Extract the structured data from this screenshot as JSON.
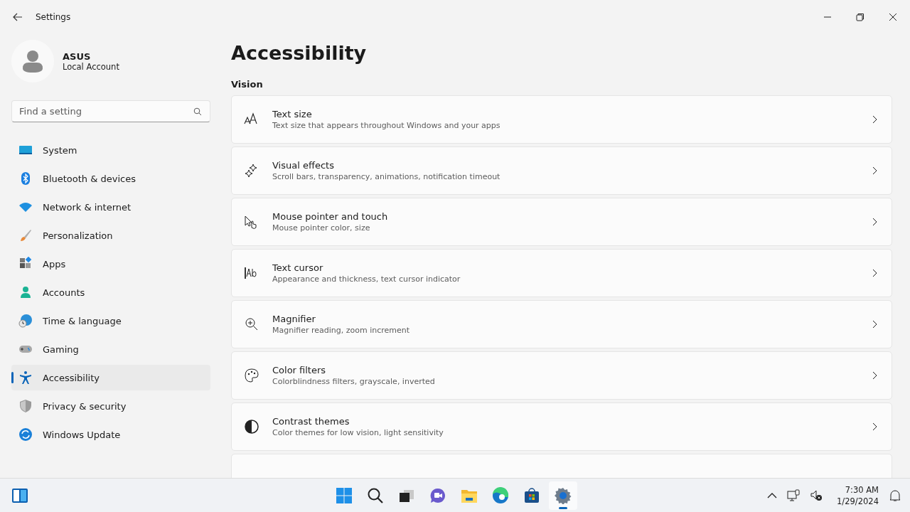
{
  "window": {
    "title": "Settings"
  },
  "account": {
    "name": "ASUS",
    "type": "Local Account"
  },
  "search": {
    "placeholder": "Find a setting"
  },
  "nav": [
    {
      "label": "System",
      "selected": false
    },
    {
      "label": "Bluetooth & devices",
      "selected": false
    },
    {
      "label": "Network & internet",
      "selected": false
    },
    {
      "label": "Personalization",
      "selected": false
    },
    {
      "label": "Apps",
      "selected": false
    },
    {
      "label": "Accounts",
      "selected": false
    },
    {
      "label": "Time & language",
      "selected": false
    },
    {
      "label": "Gaming",
      "selected": false
    },
    {
      "label": "Accessibility",
      "selected": true
    },
    {
      "label": "Privacy & security",
      "selected": false
    },
    {
      "label": "Windows Update",
      "selected": false
    }
  ],
  "page": {
    "title": "Accessibility",
    "section": "Vision",
    "items": [
      {
        "title": "Text size",
        "subtitle": "Text size that appears throughout Windows and your apps"
      },
      {
        "title": "Visual effects",
        "subtitle": "Scroll bars, transparency, animations, notification timeout"
      },
      {
        "title": "Mouse pointer and touch",
        "subtitle": "Mouse pointer color, size"
      },
      {
        "title": "Text cursor",
        "subtitle": "Appearance and thickness, text cursor indicator"
      },
      {
        "title": "Magnifier",
        "subtitle": "Magnifier reading, zoom increment"
      },
      {
        "title": "Color filters",
        "subtitle": "Colorblindness filters, grayscale, inverted"
      },
      {
        "title": "Contrast themes",
        "subtitle": "Color themes for low vision, light sensitivity"
      },
      {
        "kind": "cut-off"
      }
    ]
  },
  "taskbar": {
    "apps": [
      {
        "selected": false
      },
      {
        "selected": false
      },
      {
        "selected": false
      },
      {
        "selected": false
      },
      {
        "selected": false
      },
      {
        "selected": false
      },
      {
        "selected": false
      },
      {
        "selected": true
      }
    ],
    "time": "7:30 AM",
    "date": "1/29/2024"
  }
}
